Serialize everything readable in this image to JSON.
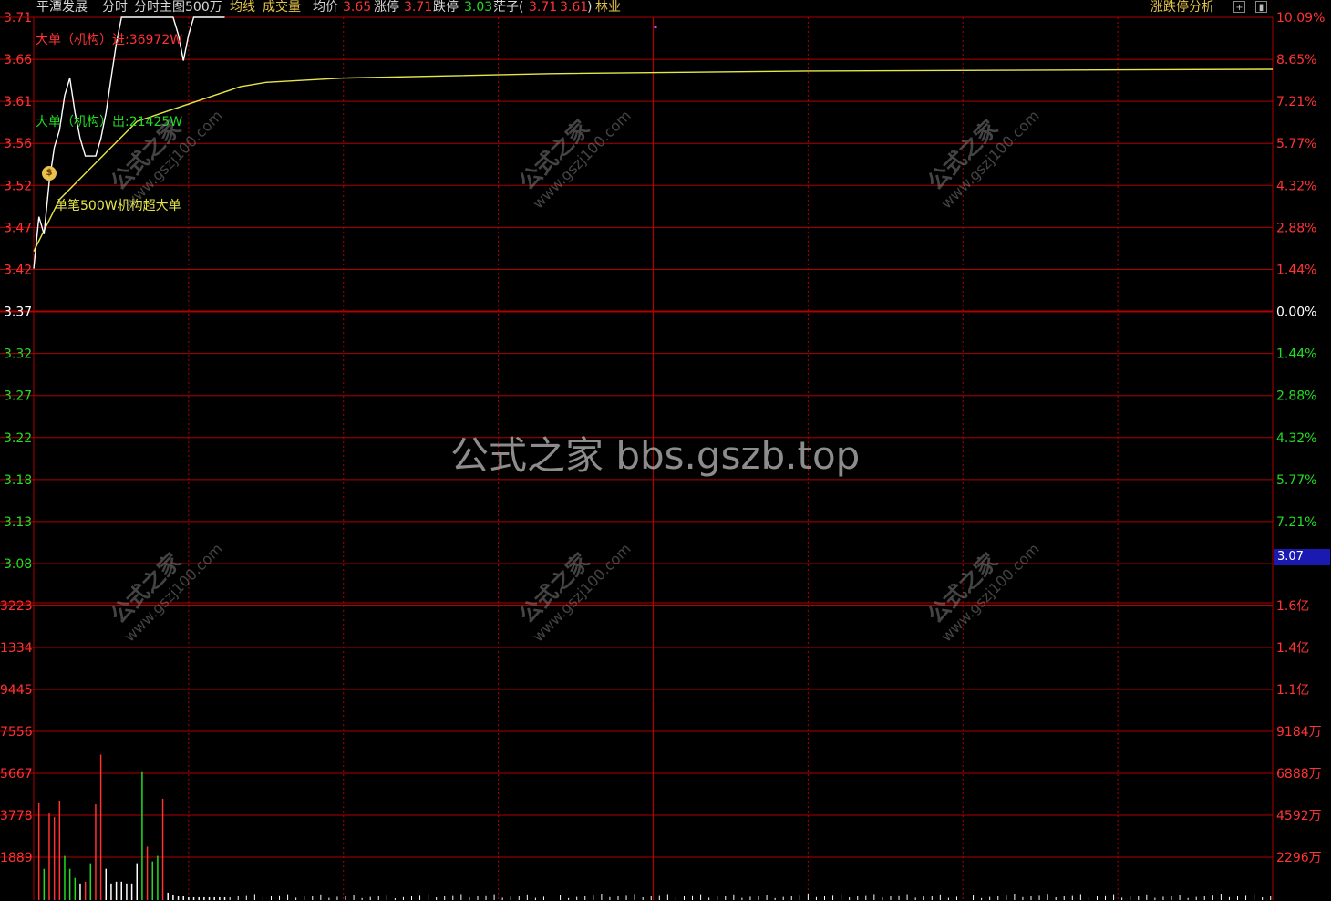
{
  "header": {
    "stock_name": "平潭发展",
    "mode_label": "分时",
    "main_chart_label": "分时主图500万",
    "avg_line_label": "均线",
    "volume_label": "成交量",
    "avg_price_label": "均价",
    "avg_price_value": "3.65",
    "limit_up_label": "涨停",
    "limit_up_value": "3.71",
    "limit_down_label": "跌停",
    "limit_down_value": "3.03",
    "sector_prefix": "茫子(",
    "sector_value1": "3.71",
    "sector_value2": "3.61",
    "sector_suffix": ")",
    "industry": "林业",
    "right_link": "涨跌停分析",
    "icon_zoom": "zoom-icon",
    "icon_window": "window-icon"
  },
  "annotations": {
    "big_in_label": "大单（机构）进:",
    "big_in_value": "36972W",
    "big_out_label": "大单（机构）出:",
    "big_out_value": "21425W",
    "single_order_label": "单笔500W机构超大单",
    "bag_icon": "money-bag-icon"
  },
  "watermark": {
    "small_text": "公式之家",
    "small_url": "www.gszj100.com",
    "big_text": "公式之家 bbs.gszb.top"
  },
  "current_price_box": "3.07",
  "colors": {
    "up": "#ff3333",
    "down": "#22dd22",
    "flat": "#ffffff",
    "price_line": "#ffffff",
    "avg_line": "#e6e64a",
    "grid": "#b00000",
    "label_yellow": "#e6c44a"
  },
  "chart_data": {
    "type": "line",
    "price_ticks": [
      "3.71",
      "3.66",
      "3.61",
      "3.56",
      "3.52",
      "3.47",
      "3.42",
      "3.37",
      "3.32",
      "3.27",
      "3.22",
      "3.18",
      "3.13",
      "3.08"
    ],
    "pct_ticks": [
      "10.09%",
      "8.65%",
      "7.21%",
      "5.77%",
      "4.32%",
      "2.88%",
      "1.44%",
      "0.00%",
      "1.44%",
      "2.88%",
      "4.32%",
      "5.77%",
      "7.21%",
      ""
    ],
    "prev_close": 3.37,
    "ylim": [
      3.08,
      3.71
    ],
    "volume_ticks_left": [
      "3223",
      "1334",
      "9445",
      "7556",
      "5667",
      "3778",
      "1889"
    ],
    "volume_ticks_right": [
      "1.6亿",
      "1.4亿",
      "1.1亿",
      "9184万",
      "6888万",
      "4592万",
      "2296万"
    ],
    "volume_max_right": "1.6亿",
    "price_series": {
      "name": "",
      "x": [
        0,
        1,
        2,
        3,
        4,
        5,
        6,
        7,
        8,
        9,
        10,
        11,
        12,
        13,
        14,
        15,
        16,
        17,
        18,
        19,
        20,
        21,
        22,
        23,
        24,
        25,
        26,
        27,
        28,
        29,
        30,
        31,
        32,
        33,
        34,
        35,
        36,
        37
      ],
      "values": [
        3.42,
        3.48,
        3.46,
        3.52,
        3.56,
        3.58,
        3.62,
        3.64,
        3.6,
        3.57,
        3.55,
        3.55,
        3.55,
        3.57,
        3.6,
        3.64,
        3.68,
        3.71,
        3.71,
        3.71,
        3.71,
        3.71,
        3.71,
        3.71,
        3.71,
        3.71,
        3.71,
        3.71,
        3.69,
        3.66,
        3.69,
        3.71,
        3.71,
        3.71,
        3.71,
        3.71,
        3.71,
        3.71
      ]
    },
    "avg_series": {
      "name": "",
      "x": [
        0,
        5,
        10,
        15,
        20,
        25,
        30,
        35,
        40,
        45,
        60,
        100,
        150,
        240
      ],
      "values": [
        3.44,
        3.5,
        3.53,
        3.56,
        3.59,
        3.6,
        3.61,
        3.62,
        3.63,
        3.635,
        3.64,
        3.645,
        3.648,
        3.65
      ]
    },
    "volume_bars": {
      "x": [
        1,
        2,
        3,
        4,
        5,
        6,
        7,
        8,
        9,
        10,
        11,
        12,
        13,
        14,
        15,
        16,
        17,
        18,
        19,
        20,
        21,
        22,
        23,
        24,
        25,
        26,
        27,
        28,
        29,
        30,
        31,
        32,
        33,
        34,
        35,
        36,
        37
      ],
      "values": [
        5300,
        1700,
        4700,
        4500,
        5400,
        2400,
        1700,
        1200,
        900,
        1000,
        2000,
        5200,
        7900,
        1700,
        900,
        1000,
        1000,
        900,
        900,
        2000,
        7000,
        2900,
        2100,
        2400,
        5500,
        400,
        300,
        200,
        200,
        150,
        150,
        150,
        150,
        150,
        150,
        150,
        150
      ],
      "colors": [
        "up",
        "down",
        "up",
        "up",
        "up",
        "down",
        "down",
        "down",
        "flat",
        "up",
        "down",
        "up",
        "up",
        "flat",
        "flat",
        "flat",
        "flat",
        "flat",
        "flat",
        "flat",
        "down",
        "up",
        "down",
        "down",
        "up",
        "flat",
        "flat",
        "flat",
        "flat",
        "flat",
        "flat",
        "flat",
        "flat",
        "flat",
        "flat",
        "flat",
        "flat"
      ]
    },
    "grid": true
  }
}
